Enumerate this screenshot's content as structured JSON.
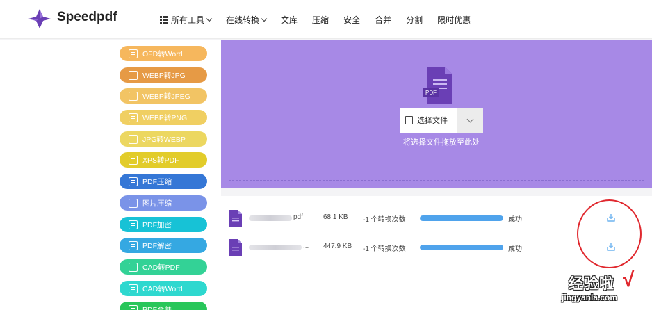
{
  "brand": {
    "name": "Speedpdf",
    "logo_color": "#6a3fb5"
  },
  "nav": {
    "all_tools": "所有工具",
    "online_convert": "在线转换",
    "wenku": "文库",
    "compress": "压缩",
    "security": "安全",
    "merge": "合并",
    "split": "分割",
    "promo": "限时优惠"
  },
  "sidebar": {
    "items": [
      {
        "label": "OFD转Word",
        "color": "#f6b75d"
      },
      {
        "label": "WEBP转JPG",
        "color": "#e69a45"
      },
      {
        "label": "WEBP转JPEG",
        "color": "#f2c464"
      },
      {
        "label": "WEBP转PNG",
        "color": "#f0cf62"
      },
      {
        "label": "JPG转WEBP",
        "color": "#ecd760"
      },
      {
        "label": "XPS转PDF",
        "color": "#e2cc2a"
      },
      {
        "label": "PDF压缩",
        "color": "#3577d6"
      },
      {
        "label": "图片压缩",
        "color": "#7a93e8"
      },
      {
        "label": "PDF加密",
        "color": "#17c2d6"
      },
      {
        "label": "PDF解密",
        "color": "#35a8e2"
      },
      {
        "label": "CAD转PDF",
        "color": "#33d296"
      },
      {
        "label": "CAD转Word",
        "color": "#2ed8cf"
      },
      {
        "label": "PDF合并",
        "color": "#28c65a"
      }
    ]
  },
  "upload": {
    "bg_color": "#a789e6",
    "file_badge": "PDF",
    "select_label": "选择文件",
    "drop_hint": "将选择文件拖放至此处"
  },
  "files": [
    {
      "name": "pdf",
      "size": "68.1 KB",
      "conversions": "-1 个转换次数",
      "progress": 1.0,
      "status": "成功"
    },
    {
      "name": "...",
      "size": "447.9 KB",
      "conversions": "-1 个转换次数",
      "progress": 1.0,
      "status": "成功"
    }
  ],
  "watermark": {
    "cn": "经验啦",
    "check": "√",
    "url": "jingyanla.com"
  }
}
